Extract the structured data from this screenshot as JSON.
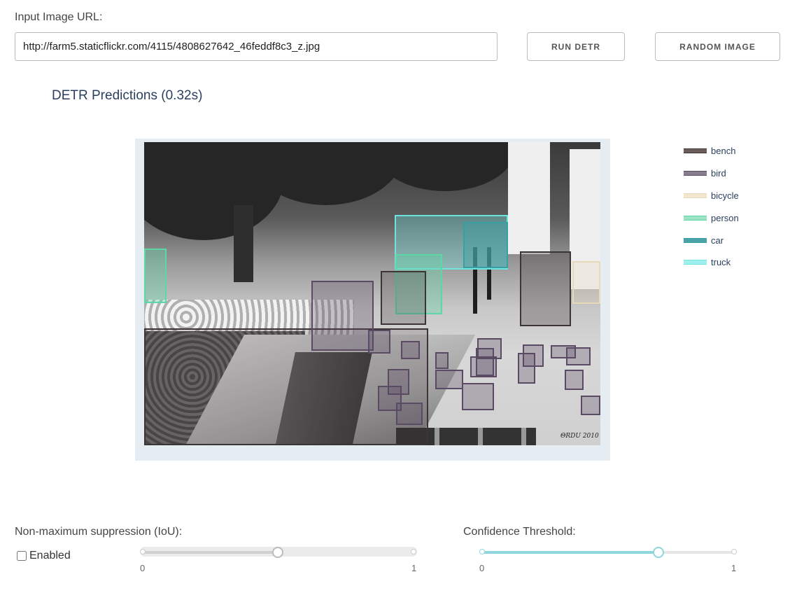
{
  "url_section": {
    "label": "Input Image URL:",
    "value": "http://farm5.staticflickr.com/4115/4808627642_46feddf8c3_z.jpg"
  },
  "buttons": {
    "run_label": "RUN DETR",
    "random_label": "RANDOM IMAGE"
  },
  "predictions": {
    "title": "DETR Predictions (0.32s)"
  },
  "legend": [
    {
      "label": "bench",
      "color": "#6b5d5d"
    },
    {
      "label": "bird",
      "color": "#857f8e"
    },
    {
      "label": "bicycle",
      "color": "#f3e6cf"
    },
    {
      "label": "person",
      "color": "#9fe3c6"
    },
    {
      "label": "car",
      "color": "#4aa3a8"
    },
    {
      "label": "truck",
      "color": "#9ff0ee"
    }
  ],
  "colors": {
    "bench": "#3d3434",
    "bird": "#5a4a63",
    "bicycle": "#e8d9b8",
    "person": "#5ed7a6",
    "car": "#3a9fa3",
    "truck": "#6fe3de",
    "plot_bg": "#e5ecf2",
    "text_title": "#2a3f5f",
    "slider_accent": "#8ed6dc"
  },
  "nms": {
    "label": "Non-maximum suppression (IoU):",
    "checkbox_label": "Enabled",
    "enabled": false,
    "value": 0.5,
    "min_label": "0",
    "max_label": "1"
  },
  "confidence": {
    "label": "Confidence Threshold:",
    "value": 0.7,
    "min_label": "0",
    "max_label": "1"
  },
  "photo": {
    "signature": "ΘRDU 2010"
  }
}
